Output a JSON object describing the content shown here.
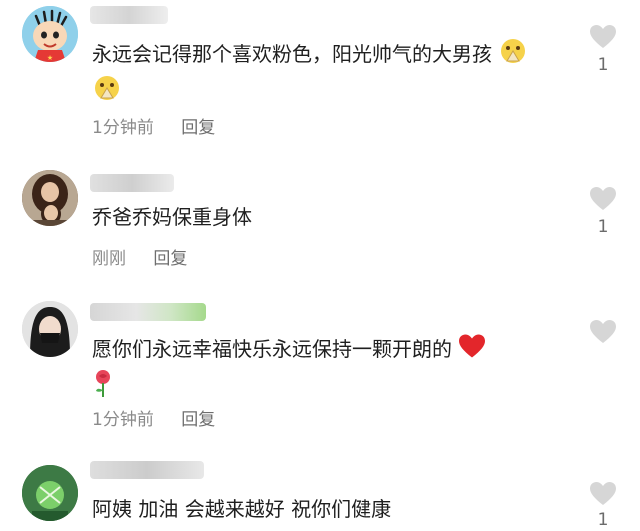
{
  "comments": [
    {
      "text": "永远会记得那个喜欢粉色，阳光帅气的大男孩",
      "time": "1分钟前",
      "reply": "回复",
      "likes": "1"
    },
    {
      "text": "乔爸乔妈保重身体",
      "time": "刚刚",
      "reply": "回复",
      "likes": "1"
    },
    {
      "text": "愿你们永远幸福快乐永远保持一颗开朗的",
      "time": "1分钟前",
      "reply": "回复",
      "likes": ""
    },
    {
      "text": "阿姨 加油 会越来越好 祝你们健康",
      "time": "",
      "reply": "",
      "likes": "1"
    }
  ],
  "icons": {
    "like": "heart-outline-icon",
    "pray": "praying-emoji",
    "heart": "red-heart-emoji",
    "rose": "rose-emoji"
  },
  "colors": {
    "text": "#1f1f1f",
    "meta": "#8a8a8a",
    "like_icon": "#d6d6d6"
  }
}
